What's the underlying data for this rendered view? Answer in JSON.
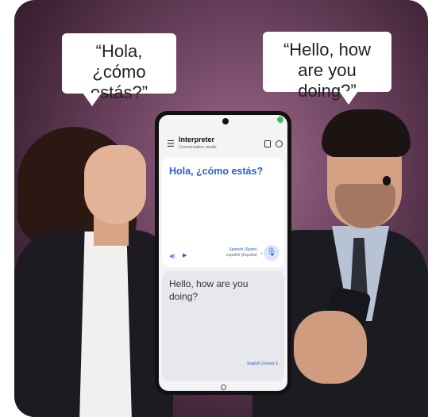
{
  "bubbles": {
    "left_text": "“Hola, ¿cómo estás?”",
    "right_text": "“Hello, how are you doing?”"
  },
  "app": {
    "title": "Interpreter",
    "subtitle": "Conversation mode",
    "menu_icon": "menu-icon",
    "header_icons": [
      "book-icon",
      "history-icon"
    ]
  },
  "source_card": {
    "text": "Hola, ¿cómo estás?",
    "language": "Spanish (Spain)",
    "language_native": "español (España)",
    "icons": [
      "speaker-icon",
      "play-icon",
      "microphone-icon"
    ]
  },
  "target_card": {
    "text": "Hello, how are you doing?",
    "language": "English (United S"
  },
  "colors": {
    "accent": "#2c5ec9",
    "background": "#6e4461"
  }
}
